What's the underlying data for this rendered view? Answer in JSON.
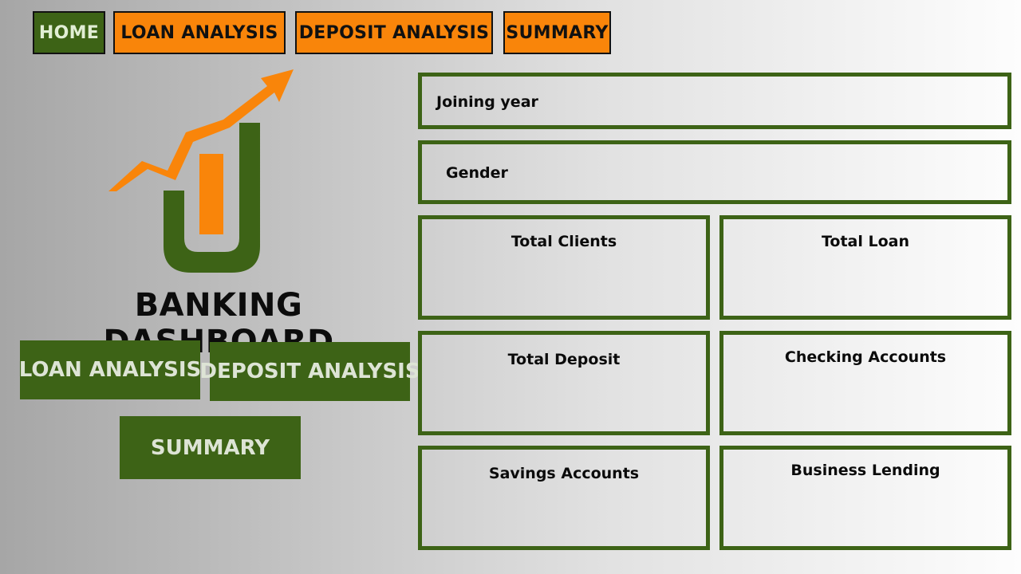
{
  "topnav": {
    "home": "HOME",
    "loan_analysis": "LOAN ANALYSIS",
    "deposit_analysis": "DEPOSIT ANALYSIS",
    "summary": "SUMMARY"
  },
  "hero": {
    "title": "BANKING DASHBOARD",
    "logo_icon": "growth-arrow-bar-logo"
  },
  "buttons": {
    "loan_analysis": "LOAN ANALYSIS",
    "deposit_analysis": "DEPOSIT ANALYSIS",
    "summary": "SUMMARY"
  },
  "filters": {
    "joining_year": "Joining year",
    "gender": "Gender"
  },
  "cards": {
    "total_clients": "Total Clients",
    "total_loan": "Total Loan",
    "total_deposit": "Total Deposit",
    "checking_accounts": "Checking Accounts",
    "savings_accounts": "Savings Accounts",
    "business_lending": "Business Lending"
  },
  "colors": {
    "green": "#3d6316",
    "orange": "#f9850a"
  }
}
